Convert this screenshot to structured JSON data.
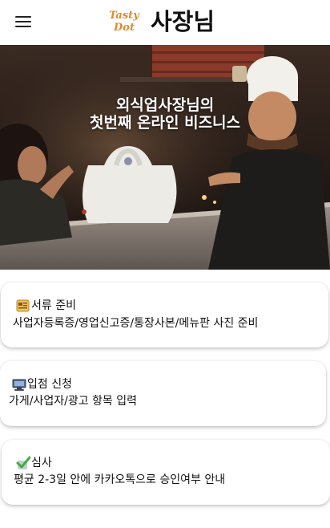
{
  "header": {
    "logo_line1": "Tasty",
    "logo_line2": "Dot",
    "title": "사장님"
  },
  "hero": {
    "line1": "외식업사장님의",
    "line2": "첫번째 온라인 비즈니스"
  },
  "steps": [
    {
      "title": "서류 준비",
      "description": "사업자등록증/영업신고증/통장사본/메뉴판 사진 준비",
      "icon": "document-icon"
    },
    {
      "title": "입점 신청",
      "description": "가게/사업자/광고 항목 입력",
      "icon": "computer-icon"
    },
    {
      "title": "심사",
      "description": "평균 2-3일 안에 카카오톡으로 승인여부 안내",
      "icon": "checkmark-icon"
    }
  ],
  "colors": {
    "logo": "#e08a2c",
    "accent_check": "#3fae3f"
  }
}
